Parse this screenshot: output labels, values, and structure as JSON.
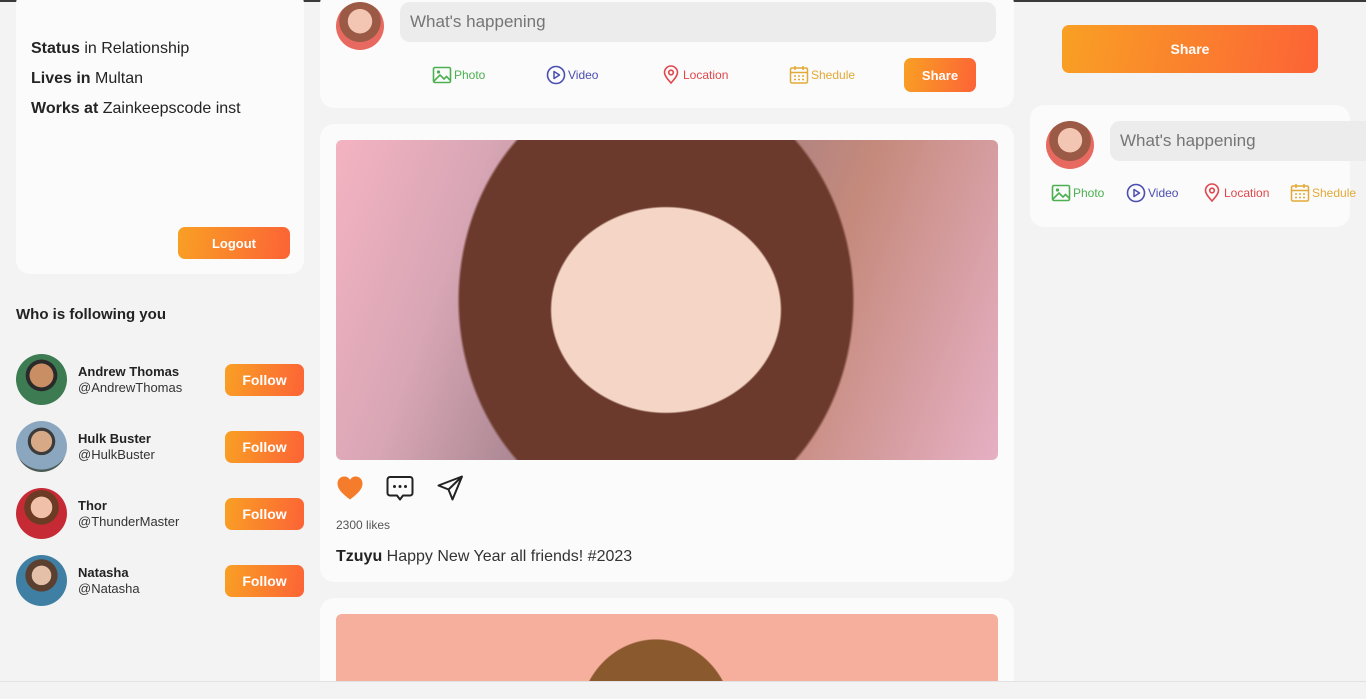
{
  "profile": {
    "status_label": "Status",
    "status_value": " in Relationship",
    "lives_label": "Lives in",
    "lives_value": " Multan",
    "works_label": "Works at",
    "works_value": " Zainkeepscode inst",
    "logout_label": "Logout"
  },
  "followers": {
    "title": "Who is following you",
    "follow_label": "Follow",
    "items": [
      {
        "name": "Andrew Thomas",
        "handle": "@AndrewThomas"
      },
      {
        "name": "Hulk Buster",
        "handle": "@HulkBuster"
      },
      {
        "name": "Thor",
        "handle": "@ThunderMaster"
      },
      {
        "name": "Natasha",
        "handle": "@Natasha"
      }
    ]
  },
  "post_share": {
    "placeholder": "What's happening",
    "photo": "Photo",
    "video": "Video",
    "location": "Location",
    "schedule": "Shedule",
    "share": "Share"
  },
  "post": {
    "likes": "2300 likes",
    "author": "Tzuyu",
    "text": " Happy New Year all friends! #2023"
  },
  "right_panel": {
    "share_button": "Share",
    "placeholder": "What's happening",
    "photo": "Photo",
    "video": "Video",
    "location": "Location",
    "schedule": "Shedule"
  },
  "colors": {
    "accent_start": "#f9a024",
    "accent_end": "#fc6336",
    "like": "#f57c2b",
    "photo": "#4caf50",
    "video": "#4b4eb1",
    "location": "#e0474c",
    "schedule": "#e2a936"
  }
}
